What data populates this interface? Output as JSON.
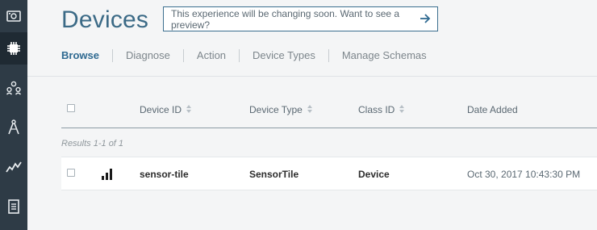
{
  "page": {
    "title": "Devices",
    "preview_banner": "This experience will be changing soon. Want to see a preview?"
  },
  "sidebar": {
    "items": [
      {
        "icon": "dashboard-icon"
      },
      {
        "icon": "chip-icon",
        "active": true
      },
      {
        "icon": "members-icon"
      },
      {
        "icon": "compass-icon"
      },
      {
        "icon": "usage-icon"
      },
      {
        "icon": "document-icon"
      }
    ]
  },
  "tabs": [
    {
      "label": "Browse",
      "active": true
    },
    {
      "label": "Diagnose"
    },
    {
      "label": "Action"
    },
    {
      "label": "Device Types"
    },
    {
      "label": "Manage Schemas"
    }
  ],
  "table": {
    "columns": [
      "Device ID",
      "Device Type",
      "Class ID",
      "Date Added"
    ],
    "results_text": "Results 1-1 of 1",
    "rows": [
      {
        "signal_icon": "signal-bars-icon",
        "device_id": "sensor-tile",
        "device_type": "SensorTile",
        "class_id": "Device",
        "date_added": "Oct 30, 2017 10:43:30 PM"
      }
    ]
  },
  "colors": {
    "sidebar": "#2e3b46",
    "accent": "#3b6a86",
    "active_tab": "#2f6a91"
  }
}
